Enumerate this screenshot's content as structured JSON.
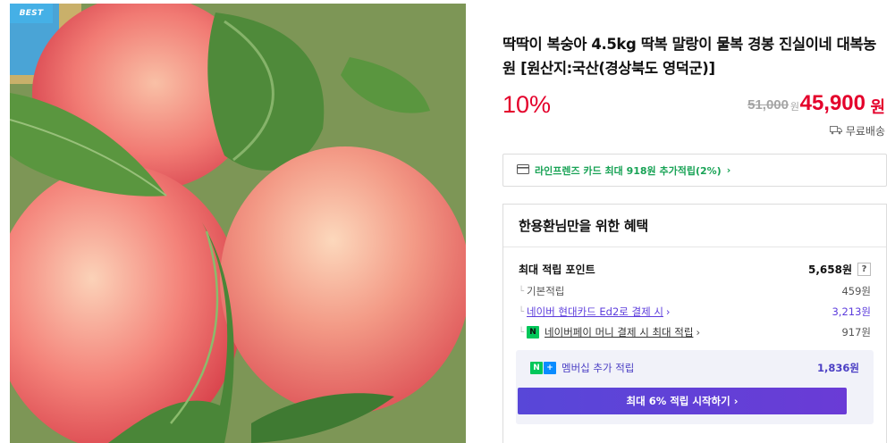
{
  "product": {
    "badge": "BEST",
    "title": "딱딱이 복숭아 4.5kg 딱복 말랑이 물복 경봉 진실이네 대복농원 [원산지:국산(경상북도 영덕군)]",
    "discount": "10%",
    "original_price": "51,000",
    "original_unit": "원",
    "price": "45,900",
    "price_unit": "원",
    "shipping": "무료배송"
  },
  "card_promo": {
    "text": "라인프렌즈 카드 최대 918원 추가적립(2%)",
    "chevron": "›"
  },
  "benefit": {
    "heading": "한용환님만을 위한 혜택",
    "max_points_label": "최대 적립 포인트",
    "max_points_value": "5,658원",
    "help": "?",
    "items": [
      {
        "label": "기본적립",
        "value": "459원"
      },
      {
        "label": "네이버 현대카드 Ed2로 결제 시",
        "value": "3,213원"
      },
      {
        "label": "네이버페이 머니 결제 시 최대 적립",
        "value": "917원"
      }
    ],
    "membership_label": "멤버십 추가 적립",
    "membership_value": "1,836원",
    "cta": "최대 6% 적립 시작하기 ›"
  },
  "icons": {
    "card": "credit-card-icon",
    "truck": "truck-icon",
    "npay": "N",
    "nplus_n": "N",
    "nplus_plus": "+"
  },
  "colors": {
    "price_red": "#e4002b",
    "naver_green": "#03c75a",
    "purple": "#5c3cdc",
    "badge_blue": "#45b0e6"
  }
}
